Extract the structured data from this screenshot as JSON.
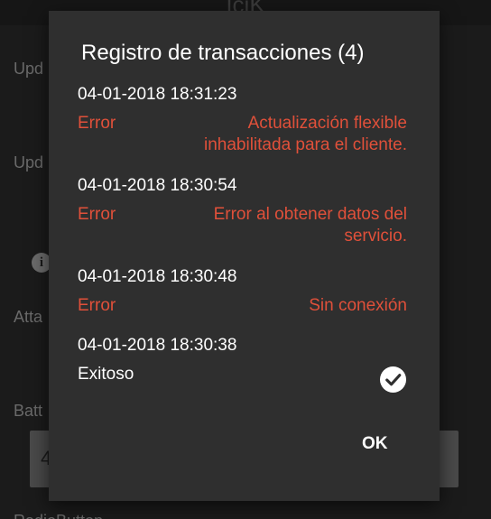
{
  "background": {
    "header_title": "IciK",
    "items": [
      "Upd",
      "Upd",
      "Atta",
      "Batt",
      "RadioButton"
    ],
    "box_text": "4"
  },
  "dialog": {
    "title": "Registro de transacciones (4)",
    "transactions": [
      {
        "datetime": "04-01-2018 18:31:23",
        "status": "Error",
        "message": "Actualización flexible inhabilitada para el cliente."
      },
      {
        "datetime": "04-01-2018 18:30:54",
        "status": "Error",
        "message": "Error al obtener datos del servicio."
      },
      {
        "datetime": "04-01-2018 18:30:48",
        "status": "Error",
        "message": "Sin conexión"
      },
      {
        "datetime": "04-01-2018 18:30:38",
        "status": "Exitoso",
        "message": "",
        "icon": "check-circle-icon"
      }
    ],
    "ok_label": "OK"
  },
  "colors": {
    "error": "#e0503a",
    "dialog_bg": "#2f2f2f",
    "text": "#ffffff"
  }
}
